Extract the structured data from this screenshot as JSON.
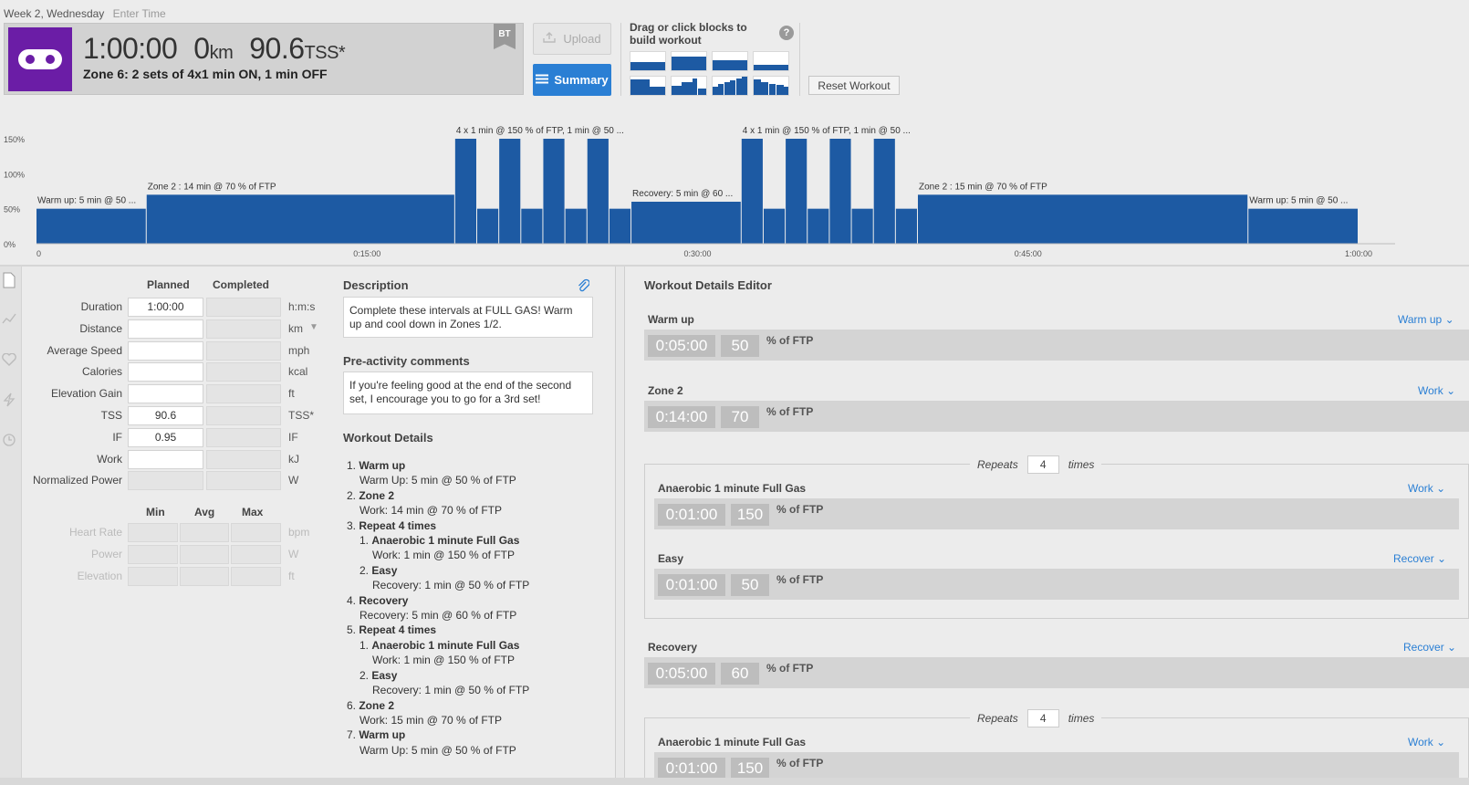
{
  "header": {
    "date": "Week 2, Wednesday",
    "enter_time": "Enter Time",
    "duration": "1:00:00",
    "distance": "0",
    "distance_unit": "km",
    "tss": "90.6",
    "tss_unit": "TSS*",
    "workout_title": "Zone 6: 2 sets of 4x1 min ON, 1 min OFF",
    "bt_badge": "BT",
    "upload_label": "Upload",
    "summary_label": "Summary"
  },
  "builder": {
    "label": "Drag or click blocks to build workout",
    "help": "?",
    "reset_label": "Reset Workout"
  },
  "chart_data": {
    "type": "bar",
    "x_unit": "minutes",
    "y_unit": "% of FTP",
    "y_ticks": [
      "150%",
      "100%",
      "50%",
      "0%"
    ],
    "x_ticks": [
      "0",
      "0:15:00",
      "0:30:00",
      "0:45:00",
      "1:00:00"
    ],
    "x_tick_values": [
      0,
      15,
      30,
      45,
      60
    ],
    "ylim": [
      0,
      150
    ],
    "segments": [
      {
        "start": 0,
        "duration": 5,
        "intensity": 50
      },
      {
        "start": 5,
        "duration": 14,
        "intensity": 70
      },
      {
        "start": 19,
        "duration": 1,
        "intensity": 150
      },
      {
        "start": 20,
        "duration": 1,
        "intensity": 50
      },
      {
        "start": 21,
        "duration": 1,
        "intensity": 150
      },
      {
        "start": 22,
        "duration": 1,
        "intensity": 50
      },
      {
        "start": 23,
        "duration": 1,
        "intensity": 150
      },
      {
        "start": 24,
        "duration": 1,
        "intensity": 50
      },
      {
        "start": 25,
        "duration": 1,
        "intensity": 150
      },
      {
        "start": 26,
        "duration": 1,
        "intensity": 50
      },
      {
        "start": 27,
        "duration": 5,
        "intensity": 60
      },
      {
        "start": 32,
        "duration": 1,
        "intensity": 150
      },
      {
        "start": 33,
        "duration": 1,
        "intensity": 50
      },
      {
        "start": 34,
        "duration": 1,
        "intensity": 150
      },
      {
        "start": 35,
        "duration": 1,
        "intensity": 50
      },
      {
        "start": 36,
        "duration": 1,
        "intensity": 150
      },
      {
        "start": 37,
        "duration": 1,
        "intensity": 50
      },
      {
        "start": 38,
        "duration": 1,
        "intensity": 150
      },
      {
        "start": 39,
        "duration": 1,
        "intensity": 50
      },
      {
        "start": 40,
        "duration": 15,
        "intensity": 70
      },
      {
        "start": 55,
        "duration": 5,
        "intensity": 50
      }
    ],
    "annotations": [
      {
        "text": "Warm up: 5 min @ 50 ...",
        "x": 0,
        "y": 50
      },
      {
        "text": "Zone 2 : 14 min @ 70 % of FTP",
        "x": 5,
        "y": 70
      },
      {
        "text": "4 x 1 min @ 150 % of FTP, 1 min @ 50 ...",
        "x": 19,
        "y": 150
      },
      {
        "text": "Recovery: 5 min @ 60 ...",
        "x": 27,
        "y": 60
      },
      {
        "text": "4 x 1 min @ 150 % of FTP, 1 min @ 50 ...",
        "x": 32,
        "y": 150
      },
      {
        "text": "Zone 2 : 15 min @ 70 % of FTP",
        "x": 40,
        "y": 70
      },
      {
        "text": "Warm up: 5 min @ 50 ...",
        "x": 55,
        "y": 50
      }
    ]
  },
  "summary": {
    "col_planned": "Planned",
    "col_completed": "Completed",
    "rows": [
      {
        "label": "Duration",
        "planned": "1:00:00",
        "unit": "h:m:s"
      },
      {
        "label": "Distance",
        "planned": "",
        "unit": "km"
      },
      {
        "label": "Average Speed",
        "planned": "",
        "unit": "mph"
      },
      {
        "label": "Calories",
        "planned": "",
        "unit": "kcal"
      },
      {
        "label": "Elevation Gain",
        "planned": "",
        "unit": "ft"
      },
      {
        "label": "TSS",
        "planned": "90.6",
        "unit": "TSS*"
      },
      {
        "label": "IF",
        "planned": "0.95",
        "unit": "IF"
      },
      {
        "label": "Work",
        "planned": "",
        "unit": "kJ"
      },
      {
        "label": "Normalized Power",
        "planned": "",
        "unit": "W"
      }
    ],
    "col_min": "Min",
    "col_avg": "Avg",
    "col_max": "Max",
    "range_rows": [
      {
        "label": "Heart Rate",
        "unit": "bpm"
      },
      {
        "label": "Power",
        "unit": "W"
      },
      {
        "label": "Elevation",
        "unit": "ft"
      }
    ]
  },
  "description": {
    "title": "Description",
    "text": "Complete these intervals at FULL GAS! Warm up and cool down in Zones 1/2.",
    "pre_title": "Pre-activity comments",
    "pre_text": "If you're feeling good at the end of the second set, I encourage you to go for a 3rd set!",
    "details_title": "Workout Details"
  },
  "workout_details": [
    {
      "num": "1.",
      "title": "Warm up",
      "sub": "Warm Up: 5 min @ 50 % of FTP"
    },
    {
      "num": "2.",
      "title": "Zone 2",
      "sub": "Work: 14 min @ 70 % of FTP"
    },
    {
      "num": "3.",
      "title": "Repeat 4 times",
      "sub": "",
      "children": [
        {
          "num": "1.",
          "title": "Anaerobic 1 minute Full Gas",
          "sub": "Work: 1 min @ 150 % of FTP"
        },
        {
          "num": "2.",
          "title": "Easy",
          "sub": "Recovery: 1 min @ 50 % of FTP"
        }
      ]
    },
    {
      "num": "4.",
      "title": "Recovery",
      "sub": "Recovery: 5 min @ 60 % of FTP"
    },
    {
      "num": "5.",
      "title": "Repeat 4 times",
      "sub": "",
      "children": [
        {
          "num": "1.",
          "title": "Anaerobic 1 minute Full Gas",
          "sub": "Work: 1 min @ 150 % of FTP"
        },
        {
          "num": "2.",
          "title": "Easy",
          "sub": "Recovery: 1 min @ 50 % of FTP"
        }
      ]
    },
    {
      "num": "6.",
      "title": "Zone 2",
      "sub": "Work: 15 min @ 70 % of FTP"
    },
    {
      "num": "7.",
      "title": "Warm up",
      "sub": "Warm Up: 5 min @ 50 % of FTP"
    }
  ],
  "editor": {
    "title": "Workout Details Editor",
    "pct_label": "% of FTP",
    "repeats_label": "Repeats",
    "times_label": "times",
    "warmup": {
      "name": "Warm up",
      "type": "Warm up",
      "time": "0:05:00",
      "pct": "50"
    },
    "zone2": {
      "name": "Zone 2",
      "type": "Work",
      "time": "0:14:00",
      "pct": "70"
    },
    "repeat1": {
      "count": "4",
      "step1": {
        "name": "Anaerobic 1 minute Full Gas",
        "type": "Work",
        "time": "0:01:00",
        "pct": "150"
      },
      "step2": {
        "name": "Easy",
        "type": "Recover",
        "time": "0:01:00",
        "pct": "50"
      }
    },
    "recovery": {
      "name": "Recovery",
      "type": "Recover",
      "time": "0:05:00",
      "pct": "60"
    },
    "repeat2": {
      "count": "4",
      "step1": {
        "name": "Anaerobic 1 minute Full Gas",
        "type": "Work",
        "time": "0:01:00",
        "pct": "150"
      }
    }
  },
  "colors": {
    "accent": "#2a7fd4",
    "bar": "#1d5aa3",
    "sport": "#6b1da6"
  }
}
